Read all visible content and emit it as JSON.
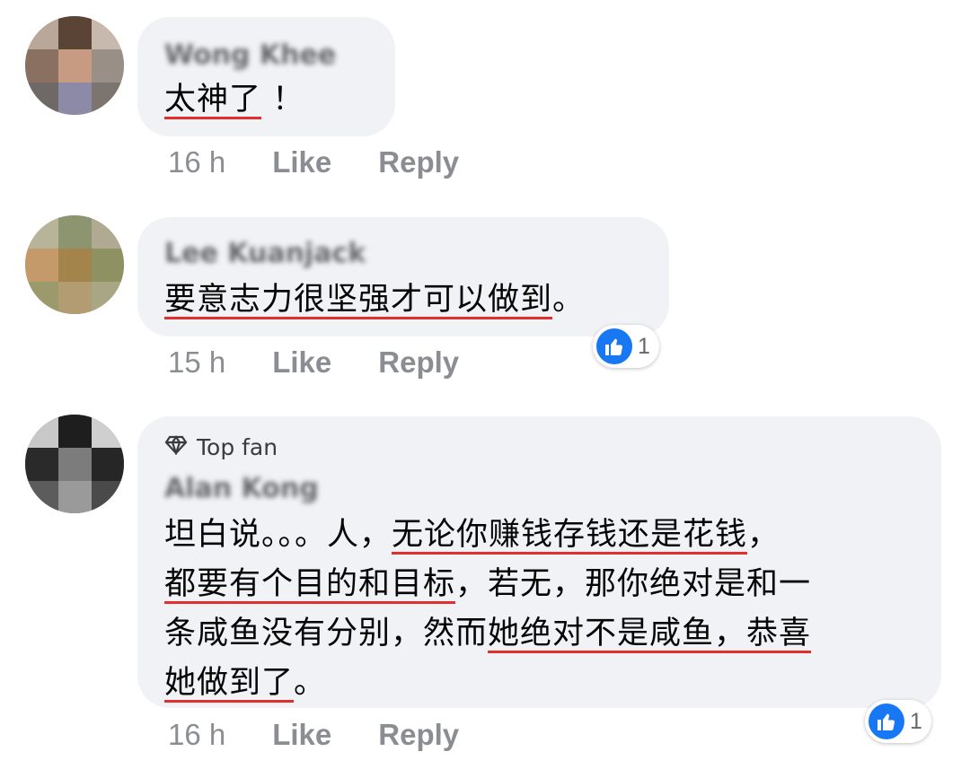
{
  "comments": [
    {
      "author": "Wong Khee",
      "text_parts": [
        {
          "t": "太神了",
          "hl": true
        },
        {
          "t": " ！",
          "hl": false
        }
      ],
      "time": "16 h",
      "like_label": "Like",
      "reply_label": "Reply"
    },
    {
      "author": "Lee Kuanjack",
      "text_parts": [
        {
          "t": "要意志力很坚强才可以做到",
          "hl": true
        },
        {
          "t": "。",
          "hl": false
        }
      ],
      "time": "15 h",
      "like_label": "Like",
      "reply_label": "Reply",
      "reaction_count": "1"
    },
    {
      "badge": "Top fan",
      "author": "Alan Kong",
      "lines": [
        [
          {
            "t": "坦白说。。。人，",
            "hl": false
          },
          {
            "t": "无论你赚钱存钱还是花钱",
            "hl": true
          },
          {
            "t": "，",
            "hl": false
          }
        ],
        [
          {
            "t": "都要有个目的和目标",
            "hl": true
          },
          {
            "t": "，若无，那你绝对是和一",
            "hl": false
          }
        ],
        [
          {
            "t": "条咸鱼没有分别，然而",
            "hl": false
          },
          {
            "t": "她绝对不是咸鱼，恭喜",
            "hl": true
          }
        ],
        [
          {
            "t": "她做到了",
            "hl": true
          },
          {
            "t": "。",
            "hl": false
          }
        ]
      ],
      "time": "16 h",
      "like_label": "Like",
      "reply_label": "Reply",
      "reaction_count": "1"
    }
  ],
  "icons": {
    "badge_icon": "diamond-icon",
    "reaction_icon": "thumbs-up-icon"
  },
  "colors": {
    "bubble": "#f0f2f5",
    "underline": "#e0302e",
    "like_blue": "#1877f2",
    "meta_gray": "#8a8d91"
  }
}
